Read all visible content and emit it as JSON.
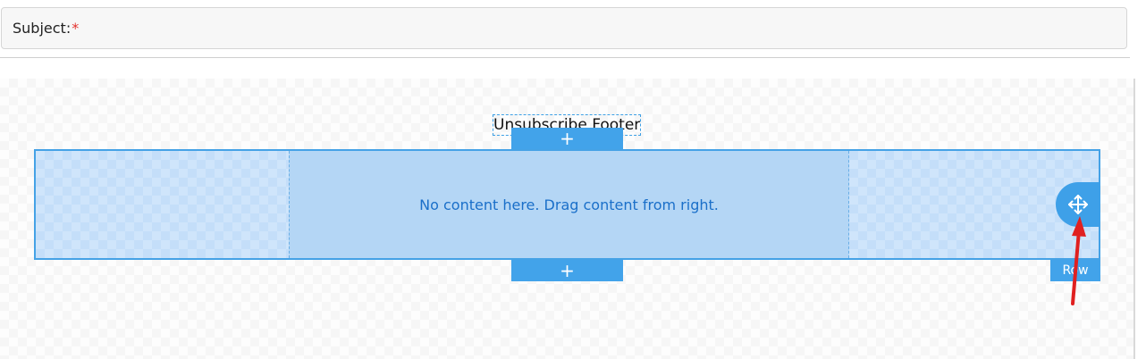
{
  "subject": {
    "label": "Subject:",
    "required_mark": "*"
  },
  "block": {
    "footer_label": "Unsubscribe Footer",
    "add_top_symbol": "+",
    "add_bottom_symbol": "+",
    "empty_message": "No content here. Drag content from right.",
    "row_tag": "Row",
    "move_icon": "move-arrows-icon"
  },
  "colors": {
    "accent": "#42a3ea",
    "row_fill": "#cfe5fb",
    "column_fill": "#b4d6f5",
    "required": "#e3332f",
    "annotation_arrow": "#e02020"
  }
}
